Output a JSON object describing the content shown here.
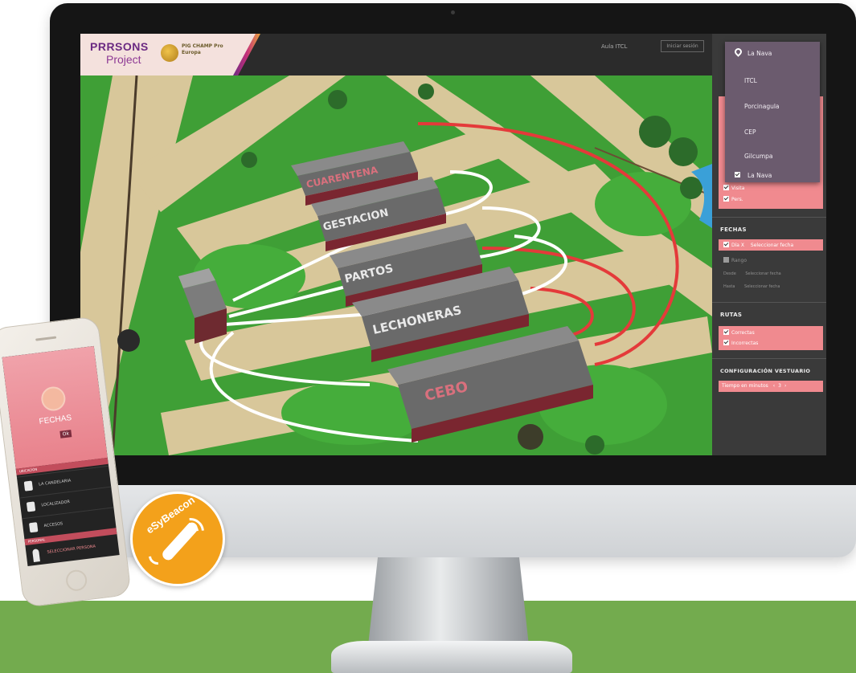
{
  "header": {
    "logo_main": "PRRSONS",
    "logo_sub": "Project",
    "partner_logo": "PIG CHAMP Pro Europa",
    "top_link": "Aula ITCL",
    "top_button": "Iniciar sesión"
  },
  "location_dropdown": {
    "selected": "La Nava",
    "options": [
      "ITCL",
      "Porcinagula",
      "CEP",
      "Gilcumpa",
      "La Nava"
    ]
  },
  "panel": {
    "filters": [
      {
        "label": "Visita",
        "checked": true
      },
      {
        "label": "Pers.",
        "checked": true
      }
    ],
    "dates": {
      "title": "FECHAS",
      "rows": [
        {
          "label": "Día X",
          "value": "Seleccionar fecha",
          "checked": true
        },
        {
          "label": "Rango",
          "value": "",
          "checked": false
        }
      ],
      "range_from": "Desde",
      "range_from_value": "Seleccionar fecha",
      "range_to": "Hasta",
      "range_to_value": "Seleccionar fecha"
    },
    "routes": {
      "title": "RUTAS",
      "items": [
        {
          "label": "Correctas",
          "checked": true
        },
        {
          "label": "Incorrectas",
          "checked": true
        }
      ]
    },
    "config": {
      "title": "CONFIGURACIÓN VESTUARIO",
      "row_label": "Tiempo en minutos",
      "row_value": "3"
    }
  },
  "barns": [
    {
      "label": "CUARENTENA"
    },
    {
      "label": "GESTACION"
    },
    {
      "label": "PARTOS"
    },
    {
      "label": "LECHONERAS"
    },
    {
      "label": "CEBO"
    }
  ],
  "phone": {
    "title": "FECHAS",
    "subtitle": "Ok",
    "section_label": "UBICACIÓN",
    "rows": [
      "LA CANDELARIA",
      "LOCALIZADOR",
      "ACCESOS"
    ],
    "band_label": "PERSONAL",
    "user_label": "SELECCIONAR PERSONA"
  },
  "beacon": {
    "label": "eSyBeacon"
  },
  "colors": {
    "accent_pink": "#f08a8f",
    "panel_bg": "#3a3a3a",
    "dropdown_bg": "#6b5b6e",
    "route_red": "#e43a3a",
    "route_white": "#ffffff",
    "grass": "#3f9f36",
    "floor_green": "#73ab4e",
    "beacon_orange": "#f3a11b"
  }
}
